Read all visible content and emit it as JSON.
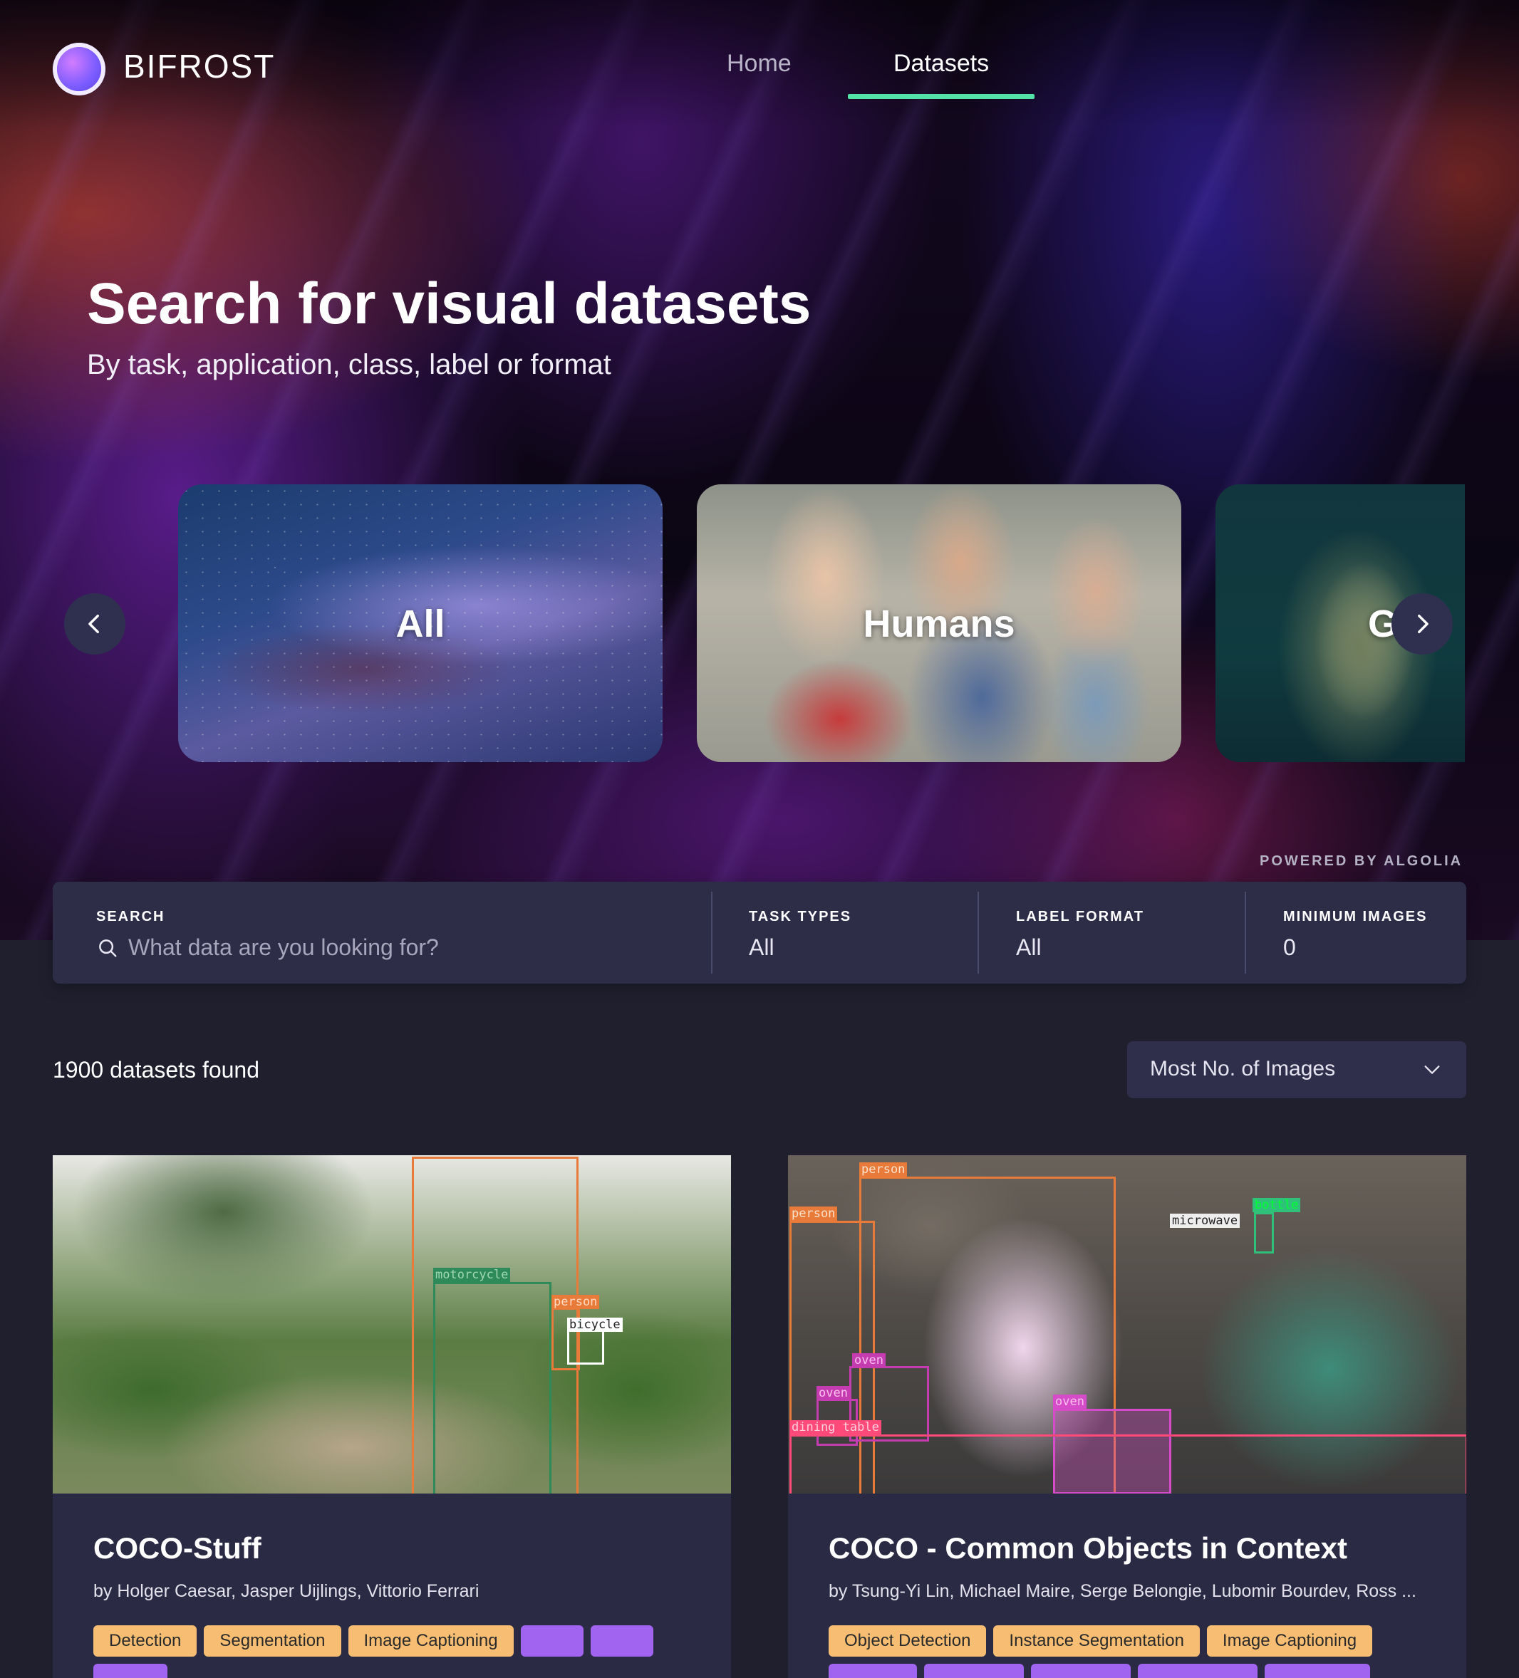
{
  "nav": {
    "brand": "BIFROST",
    "links": [
      {
        "label": "Home",
        "active": false
      },
      {
        "label": "Datasets",
        "active": true
      }
    ],
    "accent_color": "#53e3a6"
  },
  "hero": {
    "title": "Search for visual datasets",
    "subtitle": "By task, application, class, label or format"
  },
  "carousel": {
    "items": [
      {
        "label": "All"
      },
      {
        "label": "Humans"
      },
      {
        "label": "G"
      }
    ],
    "prev_icon": "chevron-left-icon",
    "next_icon": "chevron-right-icon"
  },
  "powered_by": "POWERED BY ALGOLIA",
  "search": {
    "label": "SEARCH",
    "placeholder": "What data are you looking for?",
    "task_types_label": "TASK TYPES",
    "task_types_value": "All",
    "label_format_label": "LABEL FORMAT",
    "label_format_value": "All",
    "min_images_label": "MINIMUM IMAGES",
    "min_images_value": "0"
  },
  "results": {
    "count_text": "1900 datasets found",
    "sort_value": "Most No. of Images"
  },
  "datasets": [
    {
      "title": "COCO-Stuff",
      "authors": "by Holger Caesar, Jasper Uijlings, Vittorio Ferrari",
      "annotations": [
        "motorcycle",
        "person",
        "bicycle"
      ],
      "task_tags": [
        "Detection",
        "Segmentation",
        "Image Captioning"
      ]
    },
    {
      "title": "COCO - Common Objects in Context",
      "authors": "by Tsung-Yi Lin, Michael Maire, Serge Belongie, Lubomir Bourdev, Ross ...",
      "annotations": [
        "person",
        "person",
        "microwave",
        "bottle",
        "oven",
        "oven",
        "oven",
        "dining table"
      ],
      "task_tags": [
        "Object Detection",
        "Instance Segmentation",
        "Image Captioning"
      ]
    }
  ],
  "colors": {
    "task_tag": "#f6bd73",
    "category_tag": "#a064f0",
    "panel": "#2d2d48",
    "background": "#1f1f2e"
  }
}
